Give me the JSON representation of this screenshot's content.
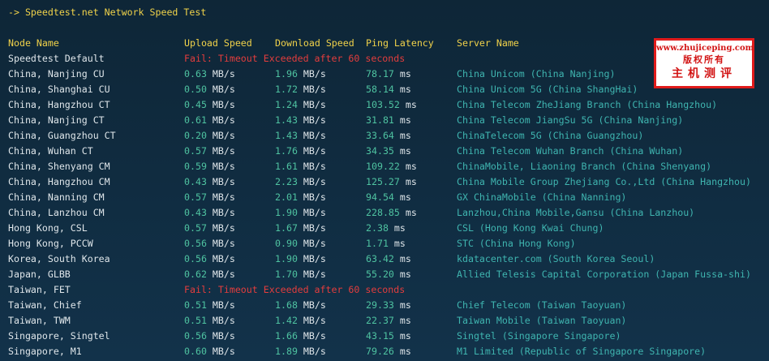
{
  "title": "-> Speedtest.net Network Speed Test",
  "headers": {
    "node": "Node Name",
    "upload": "Upload Speed",
    "download": "Download Speed",
    "ping": "Ping Latency",
    "server": "Server Name"
  },
  "unit_speed": "MB/s",
  "unit_ping": "ms",
  "rows": [
    {
      "node": "Speedtest Default",
      "fail": "Fail: Timeout Exceeded after 60 seconds"
    },
    {
      "node": "China, Nanjing CU",
      "up": "0.63",
      "down": "1.96",
      "ping": "78.17",
      "server": "China Unicom (China Nanjing)"
    },
    {
      "node": "China, Shanghai CU",
      "up": "0.50",
      "down": "1.72",
      "ping": "58.14",
      "server": "China Unicom 5G (China ShangHai)"
    },
    {
      "node": "China, Hangzhou CT",
      "up": "0.45",
      "down": "1.24",
      "ping": "103.52",
      "server": "China Telecom ZheJiang Branch (China Hangzhou)"
    },
    {
      "node": "China, Nanjing CT",
      "up": "0.61",
      "down": "1.43",
      "ping": "31.81",
      "server": "China Telecom JiangSu 5G (China Nanjing)"
    },
    {
      "node": "China, Guangzhou CT",
      "up": "0.20",
      "down": "1.43",
      "ping": "33.64",
      "server": "ChinaTelecom 5G (China Guangzhou)"
    },
    {
      "node": "China, Wuhan CT",
      "up": "0.57",
      "down": "1.76",
      "ping": "34.35",
      "server": "China Telecom Wuhan Branch (China Wuhan)"
    },
    {
      "node": "China, Shenyang CM",
      "up": "0.59",
      "down": "1.61",
      "ping": "109.22",
      "server": "ChinaMobile, Liaoning Branch (China Shenyang)"
    },
    {
      "node": "China, Hangzhou CM",
      "up": "0.43",
      "down": "2.23",
      "ping": "125.27",
      "server": "China Mobile Group Zhejiang Co.,Ltd (China Hangzhou)"
    },
    {
      "node": "China, Nanning CM",
      "up": "0.57",
      "down": "2.01",
      "ping": "94.54",
      "server": "GX ChinaMobile (China Nanning)"
    },
    {
      "node": "China, Lanzhou CM",
      "up": "0.43",
      "down": "1.90",
      "ping": "228.85",
      "server": "Lanzhou,China Mobile,Gansu (China Lanzhou)"
    },
    {
      "node": "Hong Kong, CSL",
      "up": "0.57",
      "down": "1.67",
      "ping": "2.38",
      "server": "CSL (Hong Kong Kwai Chung)"
    },
    {
      "node": "Hong Kong, PCCW",
      "up": "0.56",
      "down": "0.90",
      "ping": "1.71",
      "server": "STC (China Hong Kong)"
    },
    {
      "node": "Korea, South Korea",
      "up": "0.56",
      "down": "1.90",
      "ping": "63.42",
      "server": "kdatacenter.com (South Korea Seoul)"
    },
    {
      "node": "Japan, GLBB",
      "up": "0.62",
      "down": "1.70",
      "ping": "55.20",
      "server": "Allied Telesis Capital Corporation (Japan Fussa-shi)"
    },
    {
      "node": "Taiwan, FET",
      "fail": "Fail: Timeout Exceeded after 60 seconds"
    },
    {
      "node": "Taiwan, Chief",
      "up": "0.51",
      "down": "1.68",
      "ping": "29.33",
      "server": "Chief Telecom (Taiwan Taoyuan)"
    },
    {
      "node": "Taiwan, TWM",
      "up": "0.51",
      "down": "1.42",
      "ping": "22.37",
      "server": "Taiwan Mobile (Taiwan Taoyuan)"
    },
    {
      "node": "Singapore, Singtel",
      "up": "0.56",
      "down": "1.66",
      "ping": "43.15",
      "server": "Singtel (Singapore Singapore)"
    },
    {
      "node": "Singapore, M1",
      "up": "0.60",
      "down": "1.89",
      "ping": "79.26",
      "server": "M1 Limited (Republic of Singapore Singapore)"
    }
  ],
  "watermark": {
    "url": "www.zhujiceping.com",
    "line2": "版权所有",
    "line3": "主机测评"
  }
}
